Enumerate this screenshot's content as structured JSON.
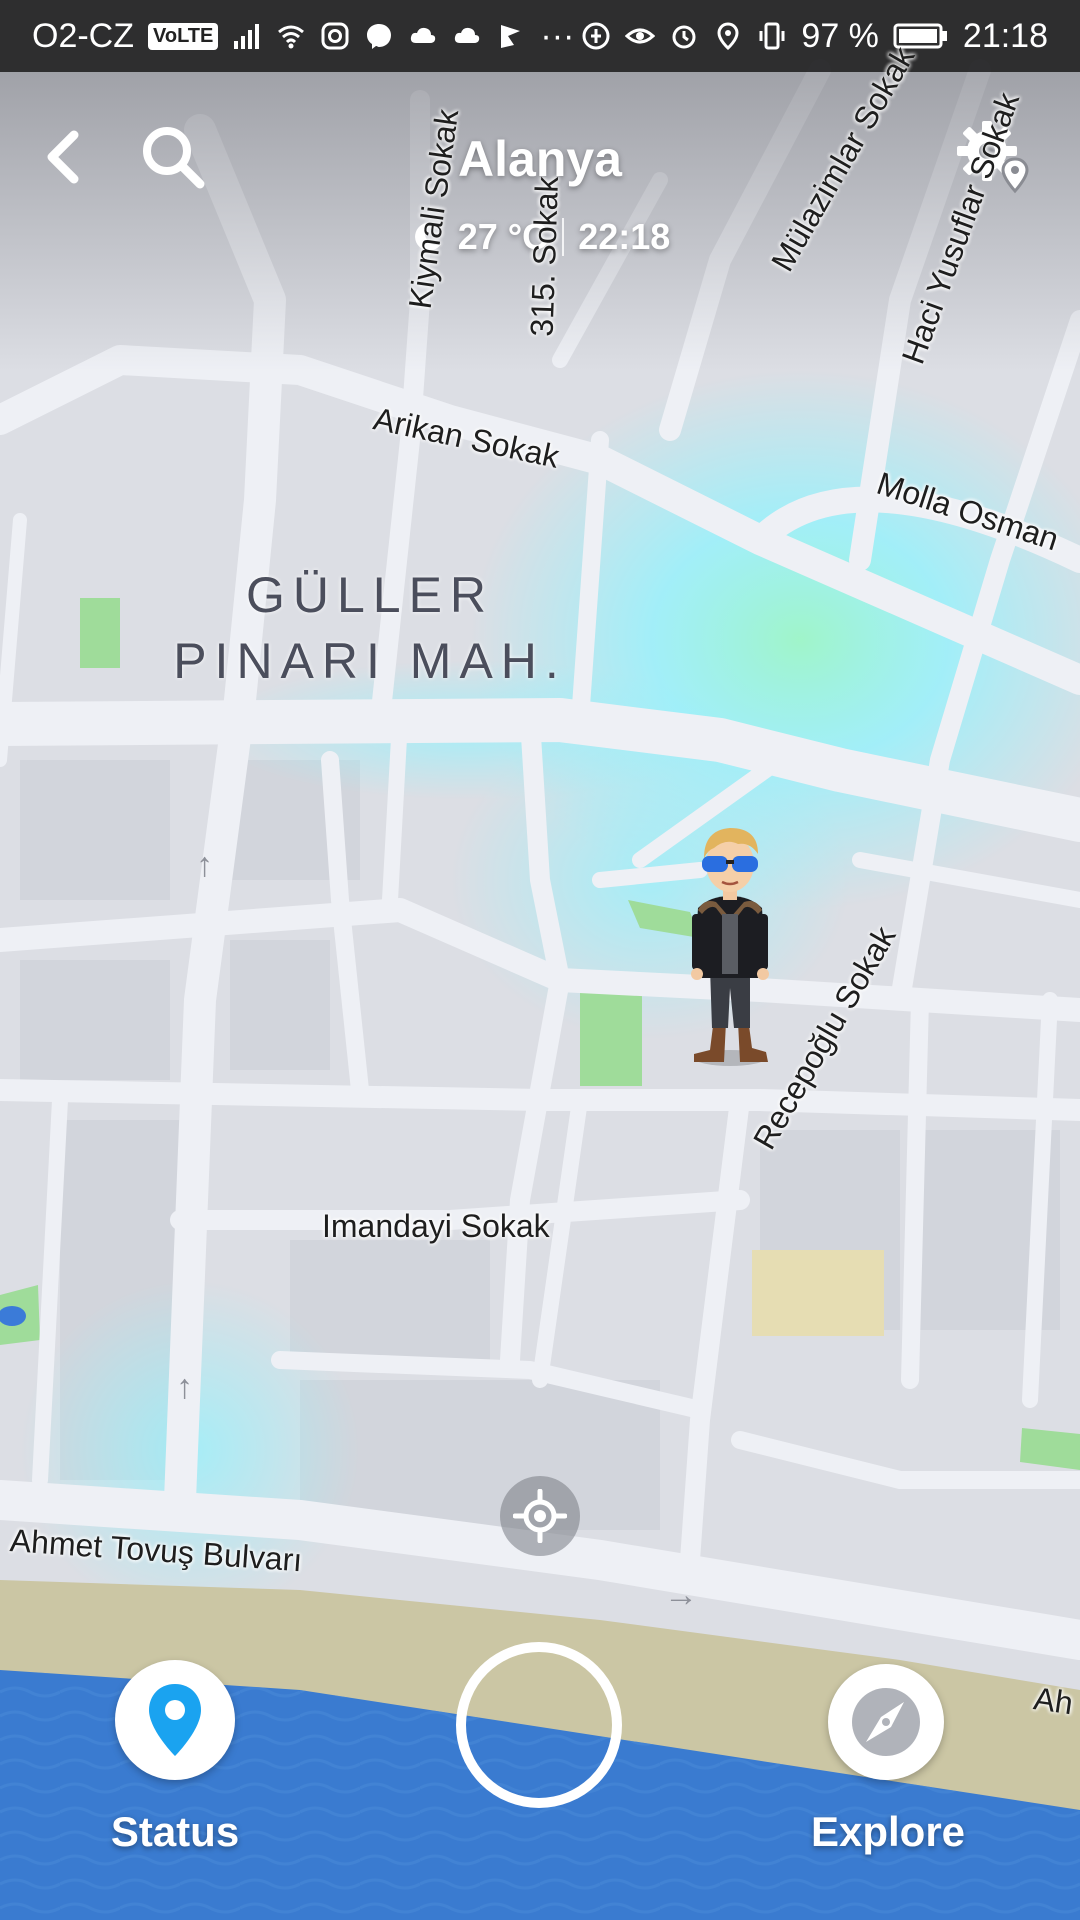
{
  "status_bar": {
    "carrier": "O2-CZ",
    "volte": "VoLTE",
    "extra": "···",
    "battery": "97 %",
    "time": "21:18"
  },
  "header": {
    "title": "Alanya",
    "temperature": "27 °C",
    "local_time": "22:18",
    "weather_icon": "moon-icon"
  },
  "map": {
    "district_line1": "GÜLLER",
    "district_line2": "PINARI MAH.",
    "streets": [
      "Kiymali Sokak",
      "315. Sokak",
      "Mülazimlar Sokak",
      "Haci Yusuflar Sokak",
      "Arikan Sokak",
      "Molla Osman",
      "Recepoğlu Sokak",
      "Imandayi Sokak",
      "Ahmet Tovuş Bulvarı",
      "Ah"
    ]
  },
  "bottom": {
    "status_label": "Status",
    "explore_label": "Explore"
  },
  "colors": {
    "accent_blue": "#1aa3f0",
    "heat_cyan": "#8ff4ff",
    "water": "#3a7bd0",
    "park": "#9fdc9a"
  }
}
